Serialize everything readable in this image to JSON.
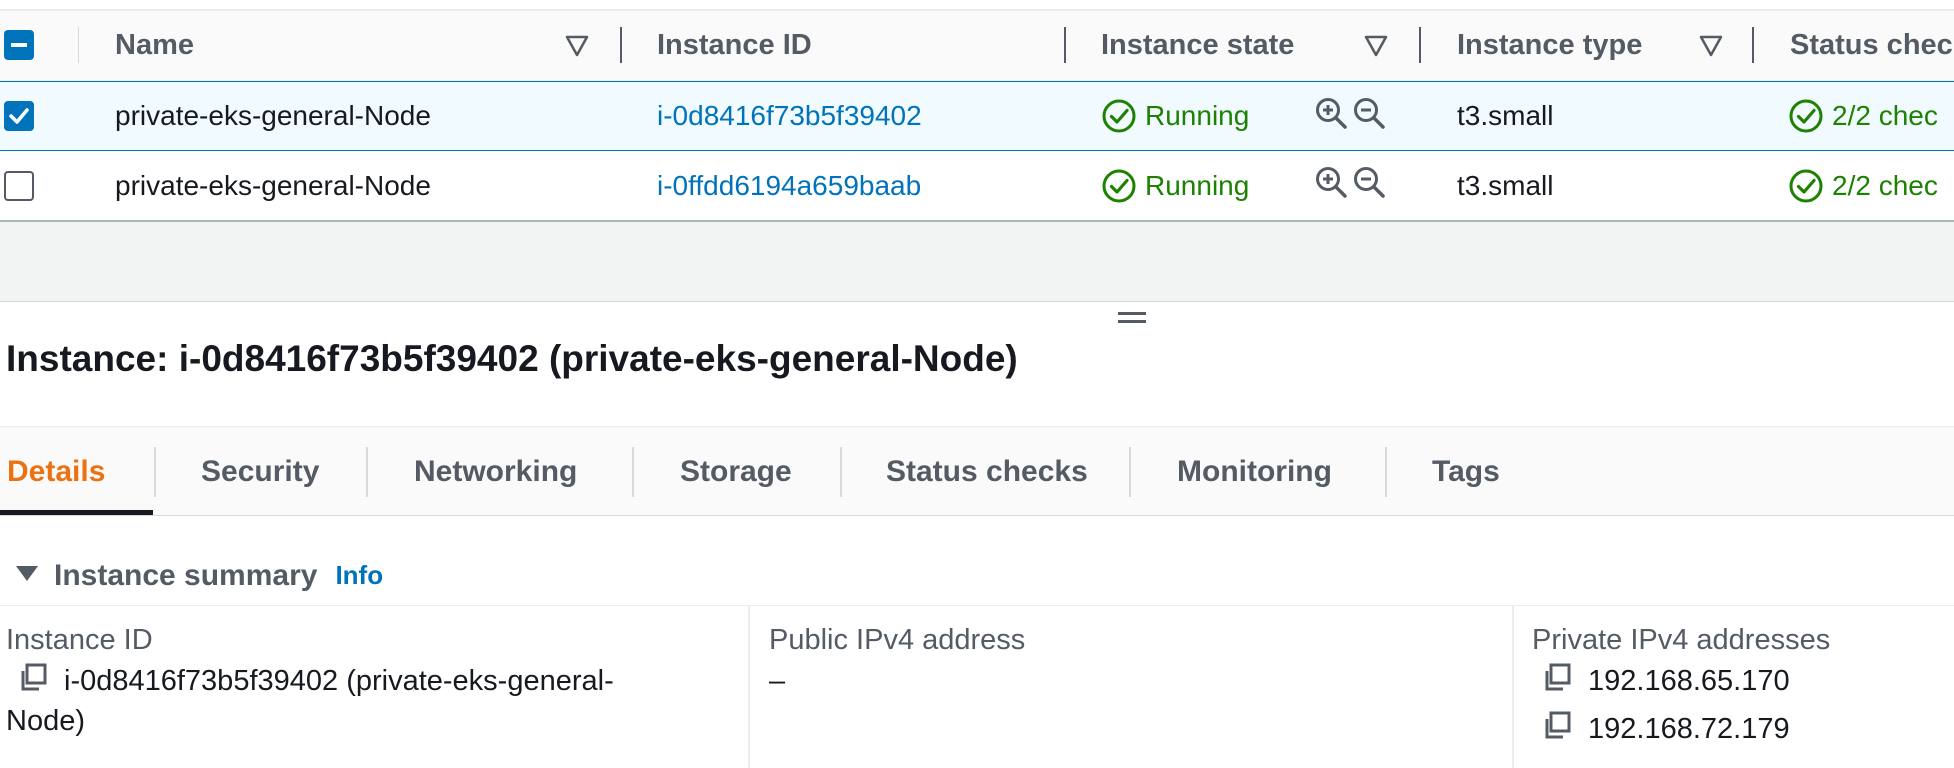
{
  "table": {
    "headers": {
      "name": "Name",
      "instance_id": "Instance ID",
      "instance_state": "Instance state",
      "instance_type": "Instance type",
      "status_check": "Status chec"
    },
    "rows": [
      {
        "selected": true,
        "name": "private-eks-general-Node",
        "instance_id": "i-0d8416f73b5f39402",
        "state": "Running",
        "type": "t3.small",
        "status": "2/2 chec"
      },
      {
        "selected": false,
        "name": "private-eks-general-Node",
        "instance_id": "i-0ffdd6194a659baab",
        "state": "Running",
        "type": "t3.small",
        "status": "2/2 chec"
      }
    ]
  },
  "detail": {
    "title": "Instance: i-0d8416f73b5f39402 (private-eks-general-Node)",
    "tabs": [
      "Details",
      "Security",
      "Networking",
      "Storage",
      "Status checks",
      "Monitoring",
      "Tags"
    ],
    "active_tab": "Details",
    "summary": {
      "label": "Instance summary",
      "info": "Info",
      "instance_id_key": "Instance ID",
      "instance_id_value_line1": "i-0d8416f73b5f39402 (private-eks-general-",
      "instance_id_value_line2": "Node)",
      "public_ip_key": "Public IPv4 address",
      "public_ip_value": "–",
      "private_ip_key": "Private IPv4 addresses",
      "private_ips": [
        "192.168.65.170",
        "192.168.72.179"
      ]
    }
  },
  "colors": {
    "link": "#0073bb",
    "running": "#1d8102",
    "active_tab": "#ec7211",
    "selected_row": "#f1faff"
  },
  "icons": [
    "select-all-checkbox-icon",
    "filter-icon",
    "check-circle-icon",
    "zoom-in-icon",
    "zoom-out-icon",
    "copy-icon",
    "caret-down-icon",
    "drag-handle-icon"
  ]
}
